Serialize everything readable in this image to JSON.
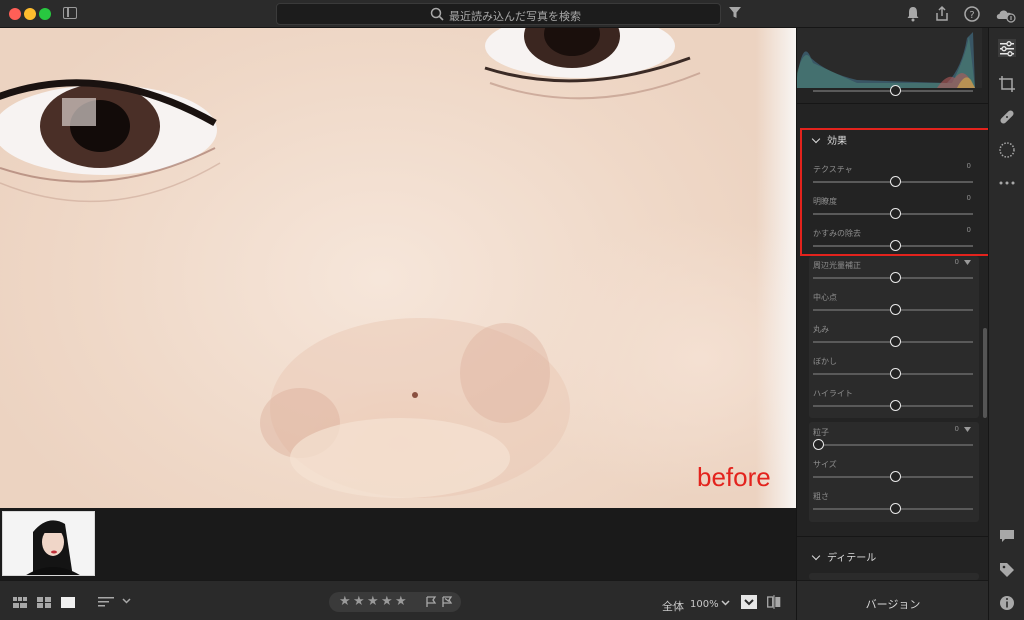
{
  "search": {
    "placeholder": "最近読み込んだ写真を検索"
  },
  "photo": {
    "overlay_label": "before"
  },
  "bottombar": {
    "stars": [
      "★",
      "★",
      "★",
      "★",
      "★"
    ],
    "zoom_label": "全体",
    "zoom_value": "100%"
  },
  "panel": {
    "effects": {
      "title": "効果",
      "sliders": [
        {
          "label": "テクスチャ",
          "value": "0",
          "position": 0.5
        },
        {
          "label": "明瞭度",
          "value": "0",
          "position": 0.5
        },
        {
          "label": "かすみの除去",
          "value": "0",
          "position": 0.5
        }
      ]
    },
    "vignette": {
      "title_label": "周辺光量補正",
      "value": "0",
      "sliders": [
        {
          "label": "中心点",
          "position": 0.5
        },
        {
          "label": "丸み",
          "position": 0.5
        },
        {
          "label": "ぼかし",
          "position": 0.5
        },
        {
          "label": "ハイライト",
          "position": 0.5
        }
      ]
    },
    "grain": {
      "title_label": "粒子",
      "value": "0",
      "sliders": [
        {
          "label": "サイズ",
          "position": 0.5
        },
        {
          "label": "粗さ",
          "position": 0.5
        }
      ]
    },
    "detail": {
      "title": "ディテール"
    },
    "version_label": "バージョン"
  },
  "colors": {
    "highlight": "#e3231d",
    "before_text": "#e3231d"
  }
}
